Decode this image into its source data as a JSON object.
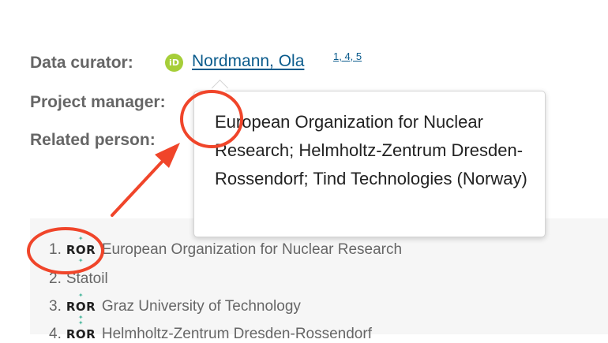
{
  "roles": {
    "data_curator_label": "Data curator:",
    "project_manager_label": "Project manager:",
    "related_person_label": "Related person:"
  },
  "person": {
    "orcid_icon": "orcid-icon",
    "orcid_text": "iD",
    "name": "Nordmann, Ola",
    "refs": "1, 4, 5"
  },
  "tooltip": {
    "text": "European Organization for Nuclear Research; Helmholtz-Zentrum Dresden-Rossendorf; Tind Technologies (Norway)"
  },
  "affiliations": [
    {
      "num": "1.",
      "ror": true,
      "name": "European Organization for Nuclear Research"
    },
    {
      "num": "2.",
      "ror": false,
      "name": "Statoil"
    },
    {
      "num": "3.",
      "ror": true,
      "name": "Graz University of Technology"
    },
    {
      "num": "4.",
      "ror": true,
      "name": "Helmholtz-Zentrum Dresden-Rossendorf"
    }
  ],
  "ror_badge": {
    "text": "ROR",
    "mark": "✦"
  },
  "colors": {
    "annotation_red": "#f0452a",
    "link_blue": "#0a5b8c",
    "orcid_green": "#a6ce39",
    "ror_green": "#53baa1"
  }
}
